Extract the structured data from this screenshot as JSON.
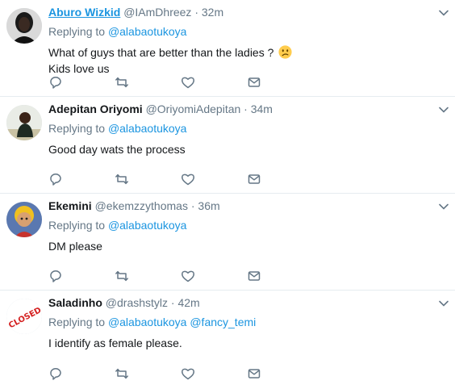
{
  "tweets": [
    {
      "name": "Aburo Wizkid",
      "handle": "@IAmDhreez",
      "sep": "·",
      "time": "32m",
      "replying_prefix": "Replying to",
      "mentions": [
        "@alabaotukoya"
      ],
      "lines": [
        "What of guys that are better than the ladies ?",
        "Kids love us"
      ],
      "emoji": "confused-face"
    },
    {
      "name": "Adepitan Oriyomi",
      "handle": "@OriyomiAdepitan",
      "sep": "·",
      "time": "34m",
      "replying_prefix": "Replying to",
      "mentions": [
        "@alabaotukoya"
      ],
      "lines": [
        "Good day wats the process"
      ]
    },
    {
      "name": "Ekemini",
      "handle": "@ekemzzythomas",
      "sep": "·",
      "time": "36m",
      "replying_prefix": "Replying to",
      "mentions": [
        "@alabaotukoya"
      ],
      "lines": [
        "DM please"
      ]
    },
    {
      "name": "Saladinho",
      "handle": "@drashstylz",
      "sep": "·",
      "time": "42m",
      "replying_prefix": "Replying to",
      "mentions": [
        "@alabaotukoya",
        "@fancy_temi"
      ],
      "lines": [
        "I identify as female please."
      ],
      "avatar_text": "CLOSED"
    }
  ],
  "colors": {
    "link": "#1b95e0",
    "secondary": "#657786",
    "icon": "#657786",
    "divider": "#e6ecf0"
  },
  "icons": [
    "reply-icon",
    "retweet-icon",
    "like-icon",
    "direct-message-icon",
    "chevron-down-icon"
  ]
}
